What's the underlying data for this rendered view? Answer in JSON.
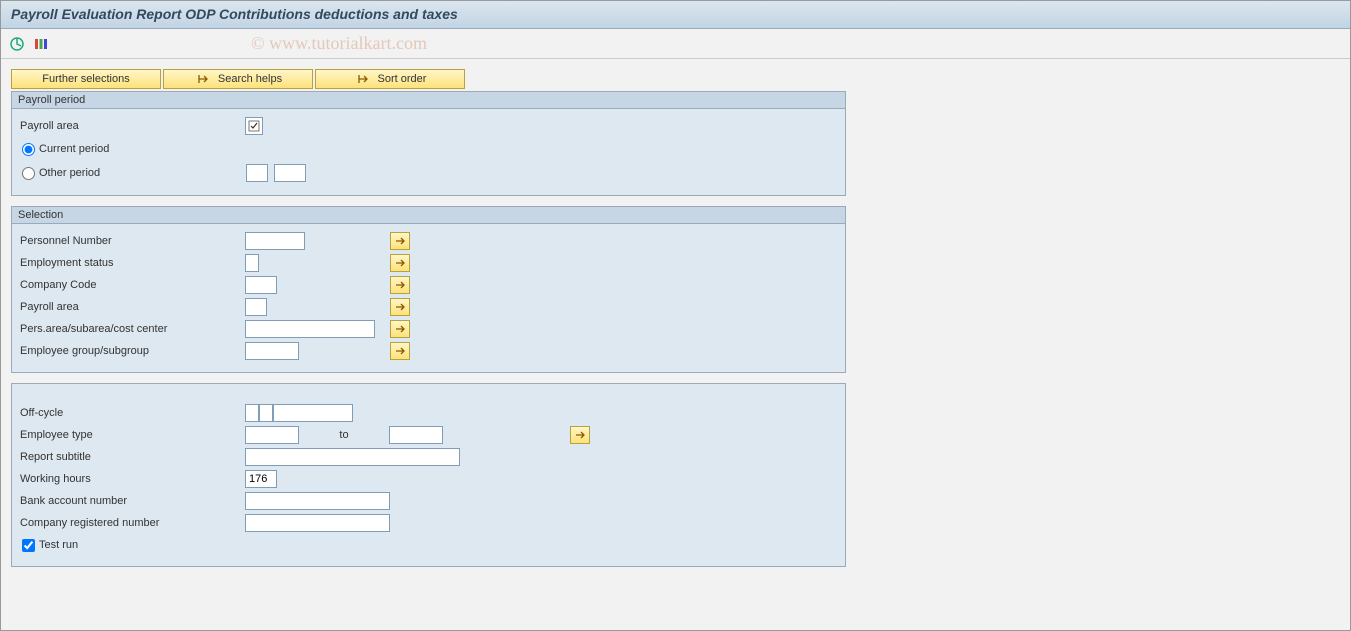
{
  "title": "Payroll Evaluation Report ODP Contributions deductions and taxes",
  "watermark": "© www.tutorialkart.com",
  "buttons": {
    "further": "Further selections",
    "search": "Search helps",
    "sort": "Sort order"
  },
  "group_payroll": {
    "title": "Payroll period",
    "area_label": "Payroll area",
    "area_value": "",
    "current_label": "Current period",
    "other_label": "Other period",
    "period_selected": "current",
    "other_v1": "",
    "other_v2": ""
  },
  "group_selection": {
    "title": "Selection",
    "rows": {
      "personnel": {
        "label": "Personnel Number",
        "value": ""
      },
      "empstatus": {
        "label": "Employment status",
        "value": ""
      },
      "company": {
        "label": "Company Code",
        "value": ""
      },
      "payarea": {
        "label": "Payroll area",
        "value": ""
      },
      "persarea": {
        "label": "Pers.area/subarea/cost center",
        "value": ""
      },
      "empgroup": {
        "label": "Employee group/subgroup",
        "value": ""
      }
    }
  },
  "group_extra": {
    "offcycle_label": "Off-cycle",
    "offcycle_v1": "",
    "offcycle_v2": "",
    "offcycle_v3": "",
    "emptype_label": "Employee type",
    "emptype_from": "",
    "to_label": "to",
    "emptype_to": "",
    "subtitle_label": "Report subtitle",
    "subtitle_value": "",
    "hours_label": "Working hours",
    "hours_value": "176",
    "bank_label": "Bank account number",
    "bank_value": "",
    "regnum_label": "Company registered number",
    "regnum_value": "",
    "testrun_label": "Test run",
    "testrun_checked": true
  }
}
